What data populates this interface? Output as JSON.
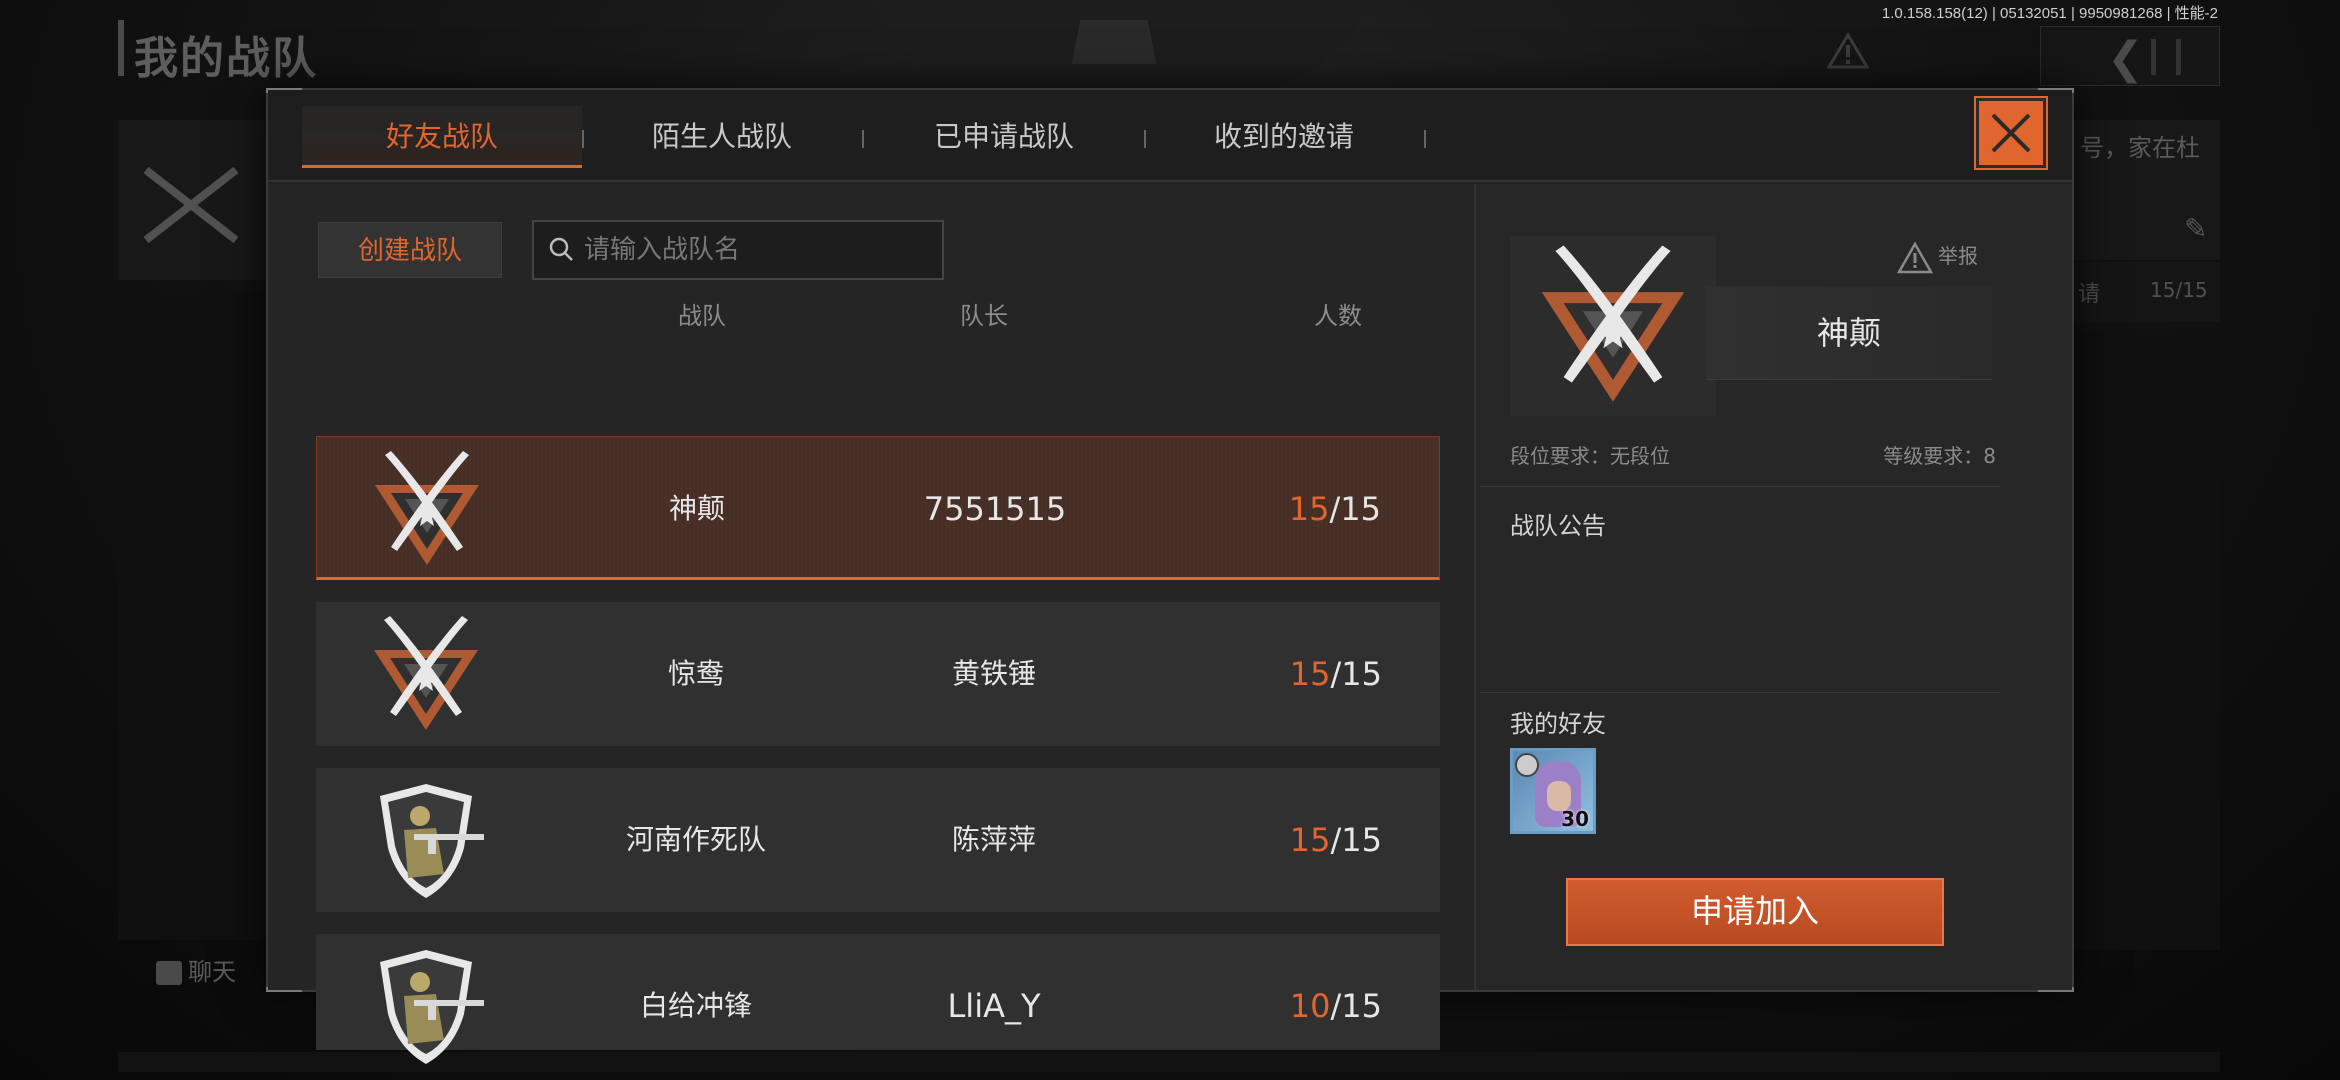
{
  "background": {
    "title": "我的战队",
    "version": "1.0.158.158(12) | 05132051 | 9950981268 | 性能-2",
    "right_text": "号，家在杜",
    "right_apply": "请",
    "right_count": "15/15",
    "chat_label": "聊天"
  },
  "tabs": [
    {
      "label": "好友战队",
      "active": true
    },
    {
      "label": "陌生人战队",
      "active": false
    },
    {
      "label": "已申请战队",
      "active": false
    },
    {
      "label": "收到的邀请",
      "active": false
    }
  ],
  "toolbar": {
    "create_label": "创建战队",
    "search_placeholder": "请输入战队名",
    "search_value": ""
  },
  "columns": {
    "team": "战队",
    "leader": "队长",
    "count": "人数"
  },
  "teams": [
    {
      "name": "神颠",
      "leader": "7551515",
      "current": "15",
      "max": "/15",
      "emblem": "crossed-knives-emblem",
      "selected": true
    },
    {
      "name": "惊鸯",
      "leader": "黄铁锤",
      "current": "15",
      "max": "/15",
      "emblem": "crossed-knives-emblem",
      "selected": false
    },
    {
      "name": "河南作死队",
      "leader": "陈萍萍",
      "current": "15",
      "max": "/15",
      "emblem": "soldier-shield-emblem",
      "selected": false
    },
    {
      "name": "白给冲锋",
      "leader": "LliA_Y",
      "current": "10",
      "max": "/15",
      "emblem": "soldier-shield-emblem",
      "selected": false
    }
  ],
  "detail": {
    "name": "神颠",
    "report_label": "举报",
    "rank_requirement": "段位要求：无段位",
    "level_requirement": "等级要求：8",
    "notice_title": "战队公告",
    "friends_title": "我的好友",
    "friend_level": "30",
    "apply_label": "申请加入"
  },
  "colors": {
    "accent": "#e0652e",
    "panel": "#252525",
    "row": "#303030"
  }
}
